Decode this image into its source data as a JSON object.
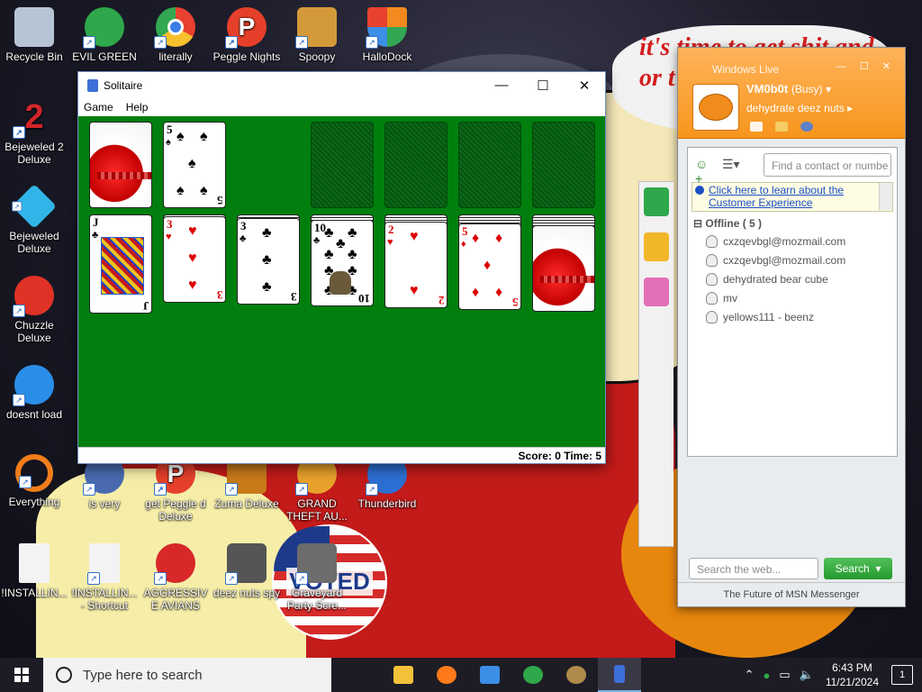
{
  "desktop": {
    "wallpaper_text": "it's time to get shit and or t",
    "icons": [
      {
        "label": "Recycle Bin",
        "color": "#b7c4d6"
      },
      {
        "label": "EVIL GREEN MSN GO",
        "color": "#2ea84a"
      },
      {
        "label": "literally",
        "color": "#e9412f"
      },
      {
        "label": "Peggle Nights Del",
        "color": "#e6402a"
      },
      {
        "label": "Spoopy",
        "color": "#d49a3a"
      },
      {
        "label": "HalloDock",
        "color": "#f28a1f"
      },
      {
        "label": "Bejeweled 2 Deluxe",
        "color": "#d0262a"
      },
      {
        "label": "Bejeweled Deluxe",
        "color": "#31b5e8"
      },
      {
        "label": "Chuzzle Deluxe",
        "color": "#e03226"
      },
      {
        "label": "doesnt load",
        "color": "#2a8ee8"
      },
      {
        "label": "Everything",
        "color": "#f07d1a"
      },
      {
        "label": "is very",
        "color": "#4a6ab0"
      },
      {
        "label": "get Peggle d Deluxe",
        "color": "#e6402a"
      },
      {
        "label": "Zuma Deluxe",
        "color": "#c77a18"
      },
      {
        "label": "GRAND THEFT AU...",
        "color": "#e8a22b"
      },
      {
        "label": "Thunderbird",
        "color": "#2c6fd2"
      },
      {
        "label": "!INSTALLIN...",
        "color": "#f3f3f3"
      },
      {
        "label": "!INSTALLIN... - Shortcut",
        "color": "#f3f3f3"
      },
      {
        "label": "AGGRESSIVE AVIANS",
        "color": "#d8282a"
      },
      {
        "label": "deez nuts spy",
        "color": "#555555"
      },
      {
        "label": "Graveyard Party Scre...",
        "color": "#c9c9c9"
      }
    ],
    "voted_sticker": "VOTED"
  },
  "solitaire": {
    "title": "Solitaire",
    "menu": [
      "Game",
      "Help"
    ],
    "status": "Score: 0 Time: 5",
    "stock_waste": {
      "waste_card": {
        "rank": "5",
        "suit": "♠"
      }
    },
    "tableau": [
      {
        "rank": "J",
        "suit": "♣",
        "color": "black"
      },
      {
        "rank": "3",
        "suit": "♥",
        "color": "red"
      },
      {
        "rank": "3",
        "suit": "♣",
        "color": "black"
      },
      {
        "rank": "10",
        "suit": "♣",
        "color": "black"
      },
      {
        "rank": "2",
        "suit": "♥",
        "color": "red"
      },
      {
        "rank": "5",
        "suit": "♦",
        "color": "red"
      },
      {
        "rank": "",
        "suit": "",
        "color": "back"
      }
    ]
  },
  "messenger": {
    "app_title": "Windows Live",
    "username": "VM0b0t",
    "status": "(Busy)",
    "personal_message": "dehydrate deez nuts",
    "find_placeholder": "Find a contact or numbe",
    "banner": "Click here to learn about the Customer Experience",
    "group": "Offline ( 5 )",
    "contacts": [
      "cxzqevbgl@mozmail.com",
      "cxzqevbgl@mozmail.com",
      "dehydrated bear cube",
      "mv",
      "yellows111 - beenz"
    ],
    "web_placeholder": "Search the web...",
    "search_button": "Search",
    "footer": "The Future of MSN Messenger"
  },
  "taskbar": {
    "search_placeholder": "Type here to search",
    "apps": [
      {
        "name": "file-explorer",
        "color": "#f3c13a"
      },
      {
        "name": "firefox",
        "color": "#ff7a1a"
      },
      {
        "name": "control-panel",
        "color": "#3c8ee6"
      },
      {
        "name": "msn-messenger",
        "color": "#2ea84a"
      },
      {
        "name": "money-bag",
        "color": "#b08a4a"
      },
      {
        "name": "solitaire",
        "color": "#3e6fd8"
      }
    ],
    "time": "6:43 PM",
    "date": "11/21/2024",
    "notifications": "1"
  }
}
